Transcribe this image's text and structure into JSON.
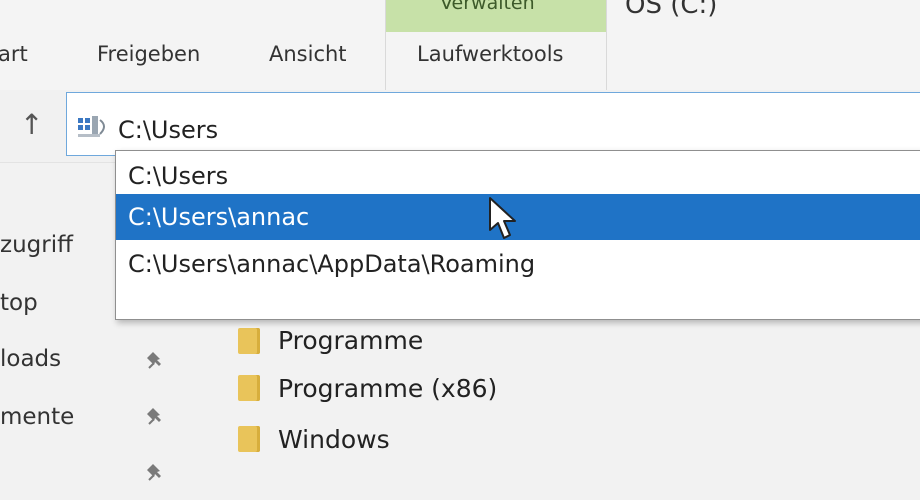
{
  "ribbon": {
    "tool_band_label": "Verwalten",
    "window_title": "OS (C:)",
    "tabs": [
      {
        "label": "art"
      },
      {
        "label": "Freigeben"
      },
      {
        "label": "Ansicht"
      },
      {
        "label": "Laufwerktools"
      }
    ]
  },
  "address": {
    "value": "C:\\Users",
    "icon": "this-pc-icon"
  },
  "autocomplete": {
    "items": [
      {
        "label": "C:\\Users",
        "selected": false
      },
      {
        "label": "C:\\Users\\annac",
        "selected": true
      },
      {
        "label": "C:\\Users\\annac\\AppData\\Roaming",
        "selected": false
      }
    ]
  },
  "nav": {
    "items": [
      {
        "label": "zugriff",
        "pinned": false
      },
      {
        "label": "top",
        "pinned": false
      },
      {
        "label": "loads",
        "pinned": true
      },
      {
        "label": "mente",
        "pinned": true
      },
      {
        "label": "",
        "pinned": true
      }
    ]
  },
  "folders": [
    {
      "label": "Programme"
    },
    {
      "label": "Programme (x86)"
    },
    {
      "label": "Windows"
    }
  ],
  "colors": {
    "selection": "#1f73c6",
    "tool_band": "#c7e1a8",
    "folder": "#e9c45a",
    "address_border": "#6fa8dc"
  }
}
